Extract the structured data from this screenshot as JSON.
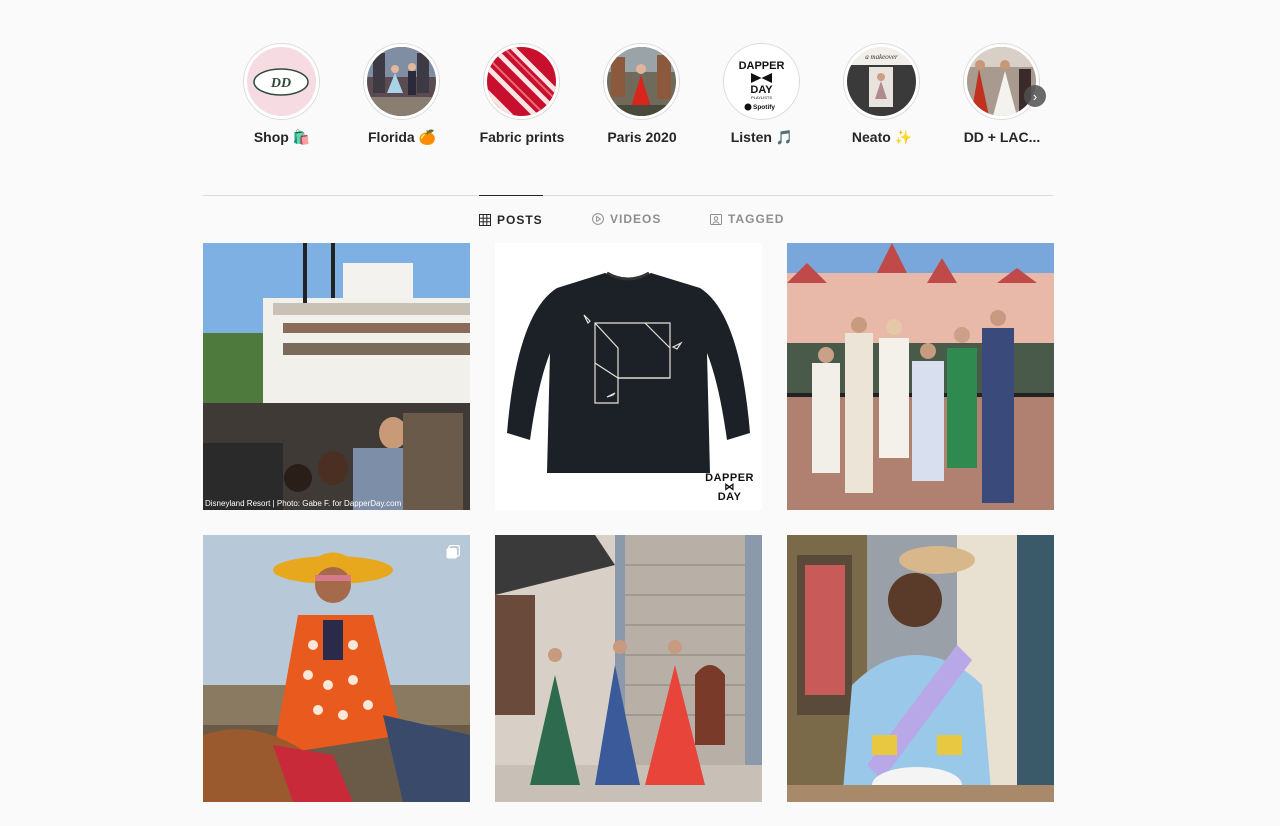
{
  "highlights": [
    {
      "label": "Shop 🛍️",
      "icon": "dapper-day-logo"
    },
    {
      "label": "Florida 🍊",
      "icon": "florida-photo"
    },
    {
      "label": "Fabric prints",
      "icon": "fabric-stripes"
    },
    {
      "label": "Paris 2020",
      "icon": "paris-photo"
    },
    {
      "label": "Listen 🎵",
      "icon": "spotify-playlist",
      "cover_lines": [
        "DAPPER",
        "DAY",
        "PLAYLISTS",
        "Spotify"
      ]
    },
    {
      "label": "Neato ✨",
      "icon": "neato-photo",
      "cover_text": "a makeover"
    },
    {
      "label": "DD + LAC...",
      "icon": "dd-lac-photo"
    }
  ],
  "tabs": [
    {
      "label": "POSTS",
      "icon": "grid-icon",
      "active": true
    },
    {
      "label": "VIDEOS",
      "icon": "play-icon",
      "active": false
    },
    {
      "label": "TAGGED",
      "icon": "tag-icon",
      "active": false
    }
  ],
  "posts": [
    {
      "description": "Riverboat with crowd waving",
      "caption": "Disneyland Resort | Photo: Gabe F. for DapperDay.com"
    },
    {
      "description": "Black sweater with bat web embroidery",
      "watermark": [
        "DAPPER",
        "DAY"
      ]
    },
    {
      "description": "Group in front of Disneyland Hotel"
    },
    {
      "description": "Woman in orange polka dot dress on horse",
      "multiple": true
    },
    {
      "description": "Three women in capes near castle tower"
    },
    {
      "description": "Woman with sash and straw hat"
    }
  ],
  "colors": {
    "background": "#fafafa",
    "border": "#dbdbdb",
    "text": "#262626",
    "muted": "#8e8e8e"
  }
}
